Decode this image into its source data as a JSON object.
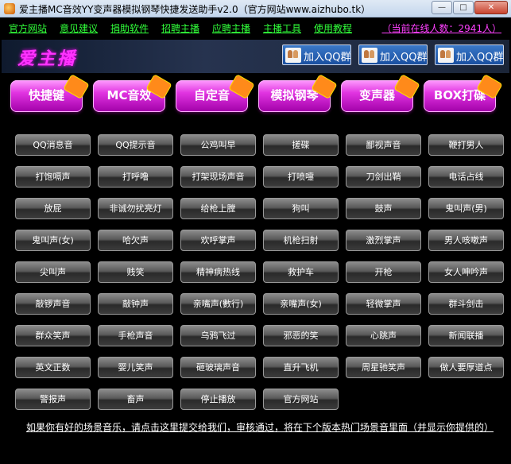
{
  "window": {
    "title": "爱主播MC音效YY变声器模拟钢琴快捷发送助手v2.0（官方网站www.aizhubo.tk）",
    "minimize": "—",
    "maximize": "□",
    "close": "✕"
  },
  "menu": {
    "items": [
      "官方网站",
      "意见建议",
      "捐助软件",
      "招聘主播",
      "应聘主播",
      "主播工具",
      "使用教程"
    ],
    "online": "（当前在线人数：2941人）"
  },
  "banner": {
    "logo": "爱主播",
    "qq_buttons": [
      "加入QQ群",
      "加入QQ群",
      "加入QQ群"
    ]
  },
  "categories": [
    "快捷键",
    "MC音效",
    "自定音",
    "模拟钢琴",
    "变声器",
    "BOX打碟"
  ],
  "sounds": [
    [
      "QQ消息音",
      "QQ提示音",
      "公鸡叫早",
      "搓碟",
      "鄙视声音",
      "鞭打男人"
    ],
    [
      "打饱嗝声",
      "打呼噜",
      "打架现场声音",
      "打喷嚏",
      "刀剑出鞘",
      "电话占线"
    ],
    [
      "放屁",
      "非诚勿扰亮灯",
      "给枪上膛",
      "狗叫",
      "鼓声",
      "鬼叫声(男)"
    ],
    [
      "鬼叫声(女)",
      "哈欠声",
      "欢呼掌声",
      "机枪扫射",
      "激烈掌声",
      "男人咳嗽声"
    ],
    [
      "尖叫声",
      "贱笑",
      "精神病热线",
      "救护车",
      "开枪",
      "女人呻吟声"
    ],
    [
      "敲锣声音",
      "敲钟声",
      "亲嘴声(數行)",
      "亲嘴声(女)",
      "轻微掌声",
      "群斗剑击"
    ],
    [
      "群众笑声",
      "手枪声音",
      "乌鸦飞过",
      "邪恶的笑",
      "心跳声",
      "新闻联播"
    ],
    [
      "英文正数",
      "婴儿笑声",
      "砸玻璃声音",
      "直升飞机",
      "周星驰笑声",
      "做人要厚道点"
    ],
    [
      "警报声",
      "畜声",
      "停止播放",
      "官方网站"
    ]
  ],
  "footer": "如果你有好的场景音乐，请点击这里提交给我们，审核通过，将在下个版本热门场景音里面（并显示你提供的）"
}
